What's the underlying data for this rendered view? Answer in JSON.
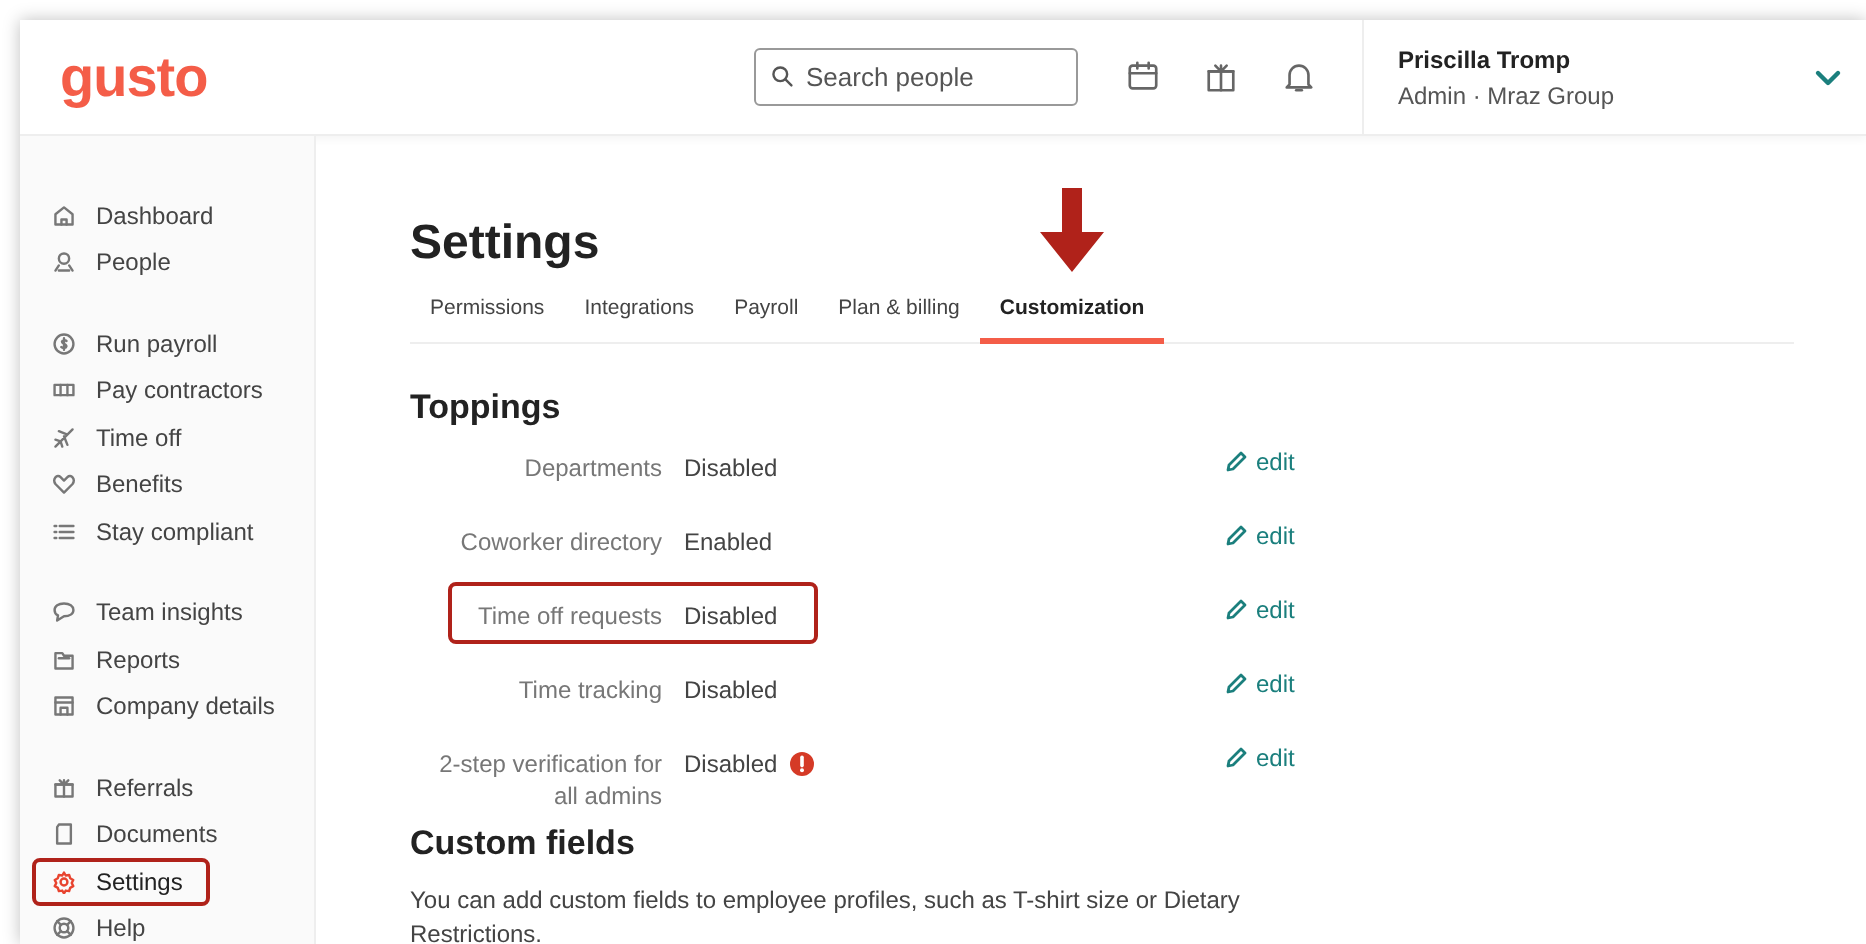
{
  "header": {
    "logo": "gusto",
    "search": {
      "placeholder": "Search people"
    },
    "user": {
      "name": "Priscilla Tromp",
      "role": "Admin · Mraz Group"
    }
  },
  "sidebar": {
    "groups": [
      {
        "items": [
          {
            "label": "Dashboard",
            "selected": false,
            "highlighted": false
          },
          {
            "label": "People",
            "selected": false,
            "highlighted": false
          }
        ]
      },
      {
        "items": [
          {
            "label": "Run payroll",
            "selected": false,
            "highlighted": false
          },
          {
            "label": "Pay contractors",
            "selected": false,
            "highlighted": false
          },
          {
            "label": "Time off",
            "selected": false,
            "highlighted": false
          },
          {
            "label": "Benefits",
            "selected": false,
            "highlighted": false
          },
          {
            "label": "Stay compliant",
            "selected": false,
            "highlighted": false
          }
        ]
      },
      {
        "items": [
          {
            "label": "Team insights",
            "selected": false,
            "highlighted": false
          },
          {
            "label": "Reports",
            "selected": false,
            "highlighted": false
          },
          {
            "label": "Company details",
            "selected": false,
            "highlighted": false
          }
        ]
      },
      {
        "items": [
          {
            "label": "Referrals",
            "selected": false,
            "highlighted": false
          },
          {
            "label": "Documents",
            "selected": false,
            "highlighted": false
          },
          {
            "label": "Settings",
            "selected": true,
            "highlighted": true
          },
          {
            "label": "Help",
            "selected": false,
            "highlighted": false
          }
        ]
      }
    ]
  },
  "page": {
    "title": "Settings",
    "tabs": [
      {
        "label": "Permissions",
        "selected": false,
        "pointed": false
      },
      {
        "label": "Integrations",
        "selected": false,
        "pointed": false
      },
      {
        "label": "Payroll",
        "selected": false,
        "pointed": false
      },
      {
        "label": "Plan & billing",
        "selected": false,
        "pointed": false
      },
      {
        "label": "Customization",
        "selected": true,
        "pointed": true
      }
    ],
    "toppings": {
      "heading": "Toppings",
      "rows": [
        {
          "label": "Departments",
          "value": "Disabled",
          "warning": false,
          "highlighted": false,
          "action": "edit"
        },
        {
          "label": "Coworker directory",
          "value": "Enabled",
          "warning": false,
          "highlighted": false,
          "action": "edit"
        },
        {
          "label": "Time off requests",
          "value": "Disabled",
          "warning": false,
          "highlighted": true,
          "action": "edit"
        },
        {
          "label": "Time tracking",
          "value": "Disabled",
          "warning": false,
          "highlighted": false,
          "action": "edit"
        },
        {
          "label": "2-step verification for all admins",
          "value": "Disabled",
          "warning": true,
          "highlighted": false,
          "action": "edit"
        }
      ]
    },
    "custom_fields": {
      "heading": "Custom fields",
      "text": "You can add custom fields to employee profiles, such as T-shirt size or Dietary Restrictions."
    }
  }
}
